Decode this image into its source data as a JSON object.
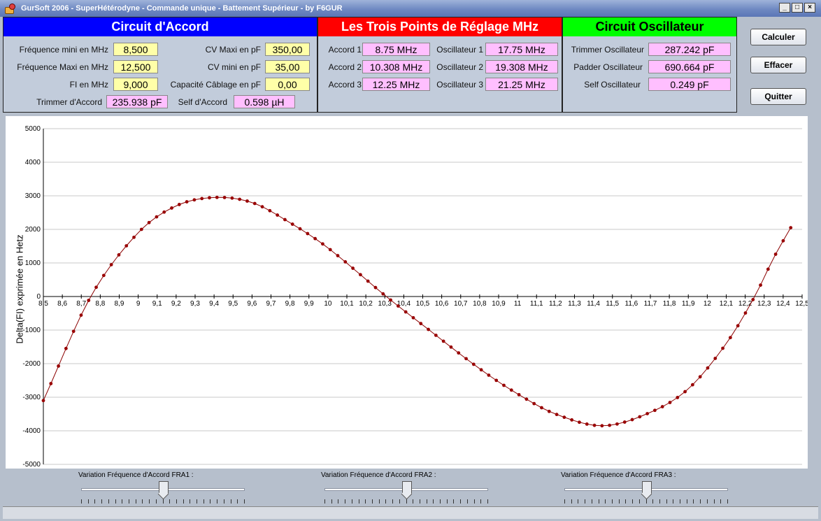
{
  "window": {
    "title": "GurSoft 2006  -  SuperHétérodyne  -  Commande unique  -  Battement Supérieur  -  by F6GUR"
  },
  "accord": {
    "header": "Circuit d'Accord",
    "freq_min_label": "Fréquence mini en MHz",
    "freq_min": "8,500",
    "freq_max_label": "Fréquence Maxi en MHz",
    "freq_max": "12,500",
    "fi_label": "FI en MHz",
    "fi": "9,000",
    "cv_max_label": "CV Maxi en pF",
    "cv_max": "350,00",
    "cv_min_label": "CV mini en pF",
    "cv_min": "35,00",
    "cap_label": "Capacité Câblage en pF",
    "cap": "0,00",
    "trimmer_label": "Trimmer d'Accord",
    "trimmer": "235.938 pF",
    "self_label": "Self d'Accord",
    "self": "0.598 µH"
  },
  "points": {
    "header": "Les Trois Points de Réglage MHz",
    "accord1_label": "Accord 1",
    "accord1": "8.75 MHz",
    "accord2_label": "Accord 2",
    "accord2": "10.308 MHz",
    "accord3_label": "Accord 3",
    "accord3": "12.25 MHz",
    "osc1_label": "Oscillateur 1",
    "osc1": "17.75 MHz",
    "osc2_label": "Oscillateur 2",
    "osc2": "19.308 MHz",
    "osc3_label": "Oscillateur 3",
    "osc3": "21.25 MHz"
  },
  "oscillateur": {
    "header": "Circuit Oscillateur",
    "trimmer_label": "Trimmer Oscillateur",
    "trimmer": "287.242 pF",
    "padder_label": "Padder Oscillateur",
    "padder": "690.664 pF",
    "self_label": "Self Oscillateur",
    "self": "0.249 pF"
  },
  "buttons": {
    "calculer": "Calculer",
    "effacer": "Effacer",
    "quitter": "Quitter"
  },
  "sliders": [
    {
      "label": "Variation Fréquence d'Accord  FRA1 :",
      "position": 0.5
    },
    {
      "label": "Variation Fréquence d'Accord  FRA2 :",
      "position": 0.5
    },
    {
      "label": "Variation Fréquence d'Accord  FRA3 :",
      "position": 0.5
    }
  ],
  "colors": {
    "curve": "#8b0000",
    "point": "#990000",
    "grid": "#c8c8c8"
  },
  "chart_data": {
    "type": "line",
    "ylabel": "Delta(FI) exprimée en Hetz",
    "xlim": [
      8.5,
      12.5
    ],
    "ylim": [
      -5000,
      5000
    ],
    "x_ticks": [
      "8,5",
      "8,6",
      "8,7",
      "8,8",
      "8,9",
      "9",
      "9,1",
      "9,2",
      "9,3",
      "9,4",
      "9,5",
      "9,6",
      "9,7",
      "9,8",
      "9,9",
      "10",
      "10,1",
      "10,2",
      "10,3",
      "10,4",
      "10,5",
      "10,6",
      "10,7",
      "10,8",
      "10,9",
      "11",
      "11,1",
      "11,2",
      "11,3",
      "11,4",
      "11,5",
      "11,6",
      "11,7",
      "11,8",
      "11,9",
      "12",
      "12,1",
      "12,2",
      "12,3",
      "12,4",
      "12,5"
    ],
    "y_ticks": [
      "5000",
      "4000",
      "3000",
      "2000",
      "1000",
      "0",
      "-1000",
      "-2000",
      "-3000",
      "-4000",
      "-5000"
    ],
    "grid": true,
    "series": [
      {
        "x_start": 8.5,
        "x_end": 12.44,
        "count": 100,
        "anchors": [
          [
            8.5,
            -3100
          ],
          [
            8.75,
            0
          ],
          [
            9.0,
            1900
          ],
          [
            9.2,
            2700
          ],
          [
            9.4,
            2950
          ],
          [
            9.6,
            2800
          ],
          [
            9.8,
            2200
          ],
          [
            10.0,
            1450
          ],
          [
            10.308,
            0
          ],
          [
            10.5,
            -850
          ],
          [
            10.8,
            -2150
          ],
          [
            11.0,
            -2900
          ],
          [
            11.2,
            -3500
          ],
          [
            11.45,
            -3850
          ],
          [
            11.7,
            -3450
          ],
          [
            11.9,
            -2750
          ],
          [
            12.1,
            -1400
          ],
          [
            12.25,
            0
          ],
          [
            12.35,
            1150
          ],
          [
            12.44,
            2050
          ]
        ]
      }
    ]
  }
}
